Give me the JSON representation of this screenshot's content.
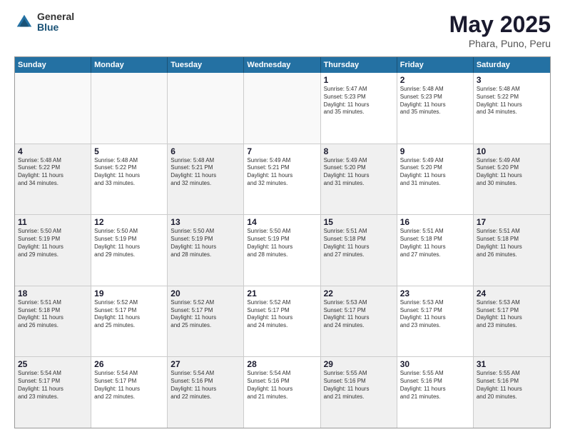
{
  "logo": {
    "general": "General",
    "blue": "Blue"
  },
  "header": {
    "month": "May 2025",
    "location": "Phara, Puno, Peru"
  },
  "days": [
    "Sunday",
    "Monday",
    "Tuesday",
    "Wednesday",
    "Thursday",
    "Friday",
    "Saturday"
  ],
  "weeks": [
    [
      {
        "day": "",
        "info": "",
        "empty": true
      },
      {
        "day": "",
        "info": "",
        "empty": true
      },
      {
        "day": "",
        "info": "",
        "empty": true
      },
      {
        "day": "",
        "info": "",
        "empty": true
      },
      {
        "day": "1",
        "info": "Sunrise: 5:47 AM\nSunset: 5:23 PM\nDaylight: 11 hours\nand 35 minutes."
      },
      {
        "day": "2",
        "info": "Sunrise: 5:48 AM\nSunset: 5:23 PM\nDaylight: 11 hours\nand 35 minutes."
      },
      {
        "day": "3",
        "info": "Sunrise: 5:48 AM\nSunset: 5:22 PM\nDaylight: 11 hours\nand 34 minutes."
      }
    ],
    [
      {
        "day": "4",
        "info": "Sunrise: 5:48 AM\nSunset: 5:22 PM\nDaylight: 11 hours\nand 34 minutes.",
        "shaded": true
      },
      {
        "day": "5",
        "info": "Sunrise: 5:48 AM\nSunset: 5:22 PM\nDaylight: 11 hours\nand 33 minutes."
      },
      {
        "day": "6",
        "info": "Sunrise: 5:48 AM\nSunset: 5:21 PM\nDaylight: 11 hours\nand 32 minutes.",
        "shaded": true
      },
      {
        "day": "7",
        "info": "Sunrise: 5:49 AM\nSunset: 5:21 PM\nDaylight: 11 hours\nand 32 minutes."
      },
      {
        "day": "8",
        "info": "Sunrise: 5:49 AM\nSunset: 5:20 PM\nDaylight: 11 hours\nand 31 minutes.",
        "shaded": true
      },
      {
        "day": "9",
        "info": "Sunrise: 5:49 AM\nSunset: 5:20 PM\nDaylight: 11 hours\nand 31 minutes."
      },
      {
        "day": "10",
        "info": "Sunrise: 5:49 AM\nSunset: 5:20 PM\nDaylight: 11 hours\nand 30 minutes.",
        "shaded": true
      }
    ],
    [
      {
        "day": "11",
        "info": "Sunrise: 5:50 AM\nSunset: 5:19 PM\nDaylight: 11 hours\nand 29 minutes.",
        "shaded": true
      },
      {
        "day": "12",
        "info": "Sunrise: 5:50 AM\nSunset: 5:19 PM\nDaylight: 11 hours\nand 29 minutes."
      },
      {
        "day": "13",
        "info": "Sunrise: 5:50 AM\nSunset: 5:19 PM\nDaylight: 11 hours\nand 28 minutes.",
        "shaded": true
      },
      {
        "day": "14",
        "info": "Sunrise: 5:50 AM\nSunset: 5:19 PM\nDaylight: 11 hours\nand 28 minutes."
      },
      {
        "day": "15",
        "info": "Sunrise: 5:51 AM\nSunset: 5:18 PM\nDaylight: 11 hours\nand 27 minutes.",
        "shaded": true
      },
      {
        "day": "16",
        "info": "Sunrise: 5:51 AM\nSunset: 5:18 PM\nDaylight: 11 hours\nand 27 minutes."
      },
      {
        "day": "17",
        "info": "Sunrise: 5:51 AM\nSunset: 5:18 PM\nDaylight: 11 hours\nand 26 minutes.",
        "shaded": true
      }
    ],
    [
      {
        "day": "18",
        "info": "Sunrise: 5:51 AM\nSunset: 5:18 PM\nDaylight: 11 hours\nand 26 minutes.",
        "shaded": true
      },
      {
        "day": "19",
        "info": "Sunrise: 5:52 AM\nSunset: 5:17 PM\nDaylight: 11 hours\nand 25 minutes."
      },
      {
        "day": "20",
        "info": "Sunrise: 5:52 AM\nSunset: 5:17 PM\nDaylight: 11 hours\nand 25 minutes.",
        "shaded": true
      },
      {
        "day": "21",
        "info": "Sunrise: 5:52 AM\nSunset: 5:17 PM\nDaylight: 11 hours\nand 24 minutes."
      },
      {
        "day": "22",
        "info": "Sunrise: 5:53 AM\nSunset: 5:17 PM\nDaylight: 11 hours\nand 24 minutes.",
        "shaded": true
      },
      {
        "day": "23",
        "info": "Sunrise: 5:53 AM\nSunset: 5:17 PM\nDaylight: 11 hours\nand 23 minutes."
      },
      {
        "day": "24",
        "info": "Sunrise: 5:53 AM\nSunset: 5:17 PM\nDaylight: 11 hours\nand 23 minutes.",
        "shaded": true
      }
    ],
    [
      {
        "day": "25",
        "info": "Sunrise: 5:54 AM\nSunset: 5:17 PM\nDaylight: 11 hours\nand 23 minutes.",
        "shaded": true
      },
      {
        "day": "26",
        "info": "Sunrise: 5:54 AM\nSunset: 5:17 PM\nDaylight: 11 hours\nand 22 minutes."
      },
      {
        "day": "27",
        "info": "Sunrise: 5:54 AM\nSunset: 5:16 PM\nDaylight: 11 hours\nand 22 minutes.",
        "shaded": true
      },
      {
        "day": "28",
        "info": "Sunrise: 5:54 AM\nSunset: 5:16 PM\nDaylight: 11 hours\nand 21 minutes."
      },
      {
        "day": "29",
        "info": "Sunrise: 5:55 AM\nSunset: 5:16 PM\nDaylight: 11 hours\nand 21 minutes.",
        "shaded": true
      },
      {
        "day": "30",
        "info": "Sunrise: 5:55 AM\nSunset: 5:16 PM\nDaylight: 11 hours\nand 21 minutes."
      },
      {
        "day": "31",
        "info": "Sunrise: 5:55 AM\nSunset: 5:16 PM\nDaylight: 11 hours\nand 20 minutes.",
        "shaded": true
      }
    ]
  ]
}
